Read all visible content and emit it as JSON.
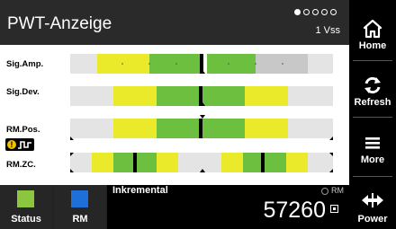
{
  "header": {
    "title": "PWT-Anzeige",
    "range": "1 Vss",
    "page_indicator": {
      "total": 5,
      "active": 1
    }
  },
  "rows": [
    {
      "label": "Sig.Amp."
    },
    {
      "label": "Sig.Dev."
    },
    {
      "label": "RM.Pos."
    },
    {
      "label": "RM.ZC."
    }
  ],
  "warning_icons": [
    "warning-icon",
    "signal-wave-icon"
  ],
  "colors": {
    "green": "#6dbf3f",
    "yellow": "#eaea2a",
    "grey": "#c8c8c8",
    "light_grey": "#e4e4e4",
    "status_green": "#8cc63f",
    "rm_blue": "#1e6fd9"
  },
  "sidebar": {
    "home_label": "Home",
    "refresh_label": "Refresh",
    "more_label": "More",
    "power_label": "Power",
    "icons": [
      "home-icon",
      "refresh-icon",
      "menu-icon",
      "power-icon"
    ]
  },
  "bottom": {
    "status_label": "Status",
    "rm_label": "RM",
    "counter_name": "Inkremental",
    "rm_indicator": "RM",
    "counter_value": "57260"
  }
}
